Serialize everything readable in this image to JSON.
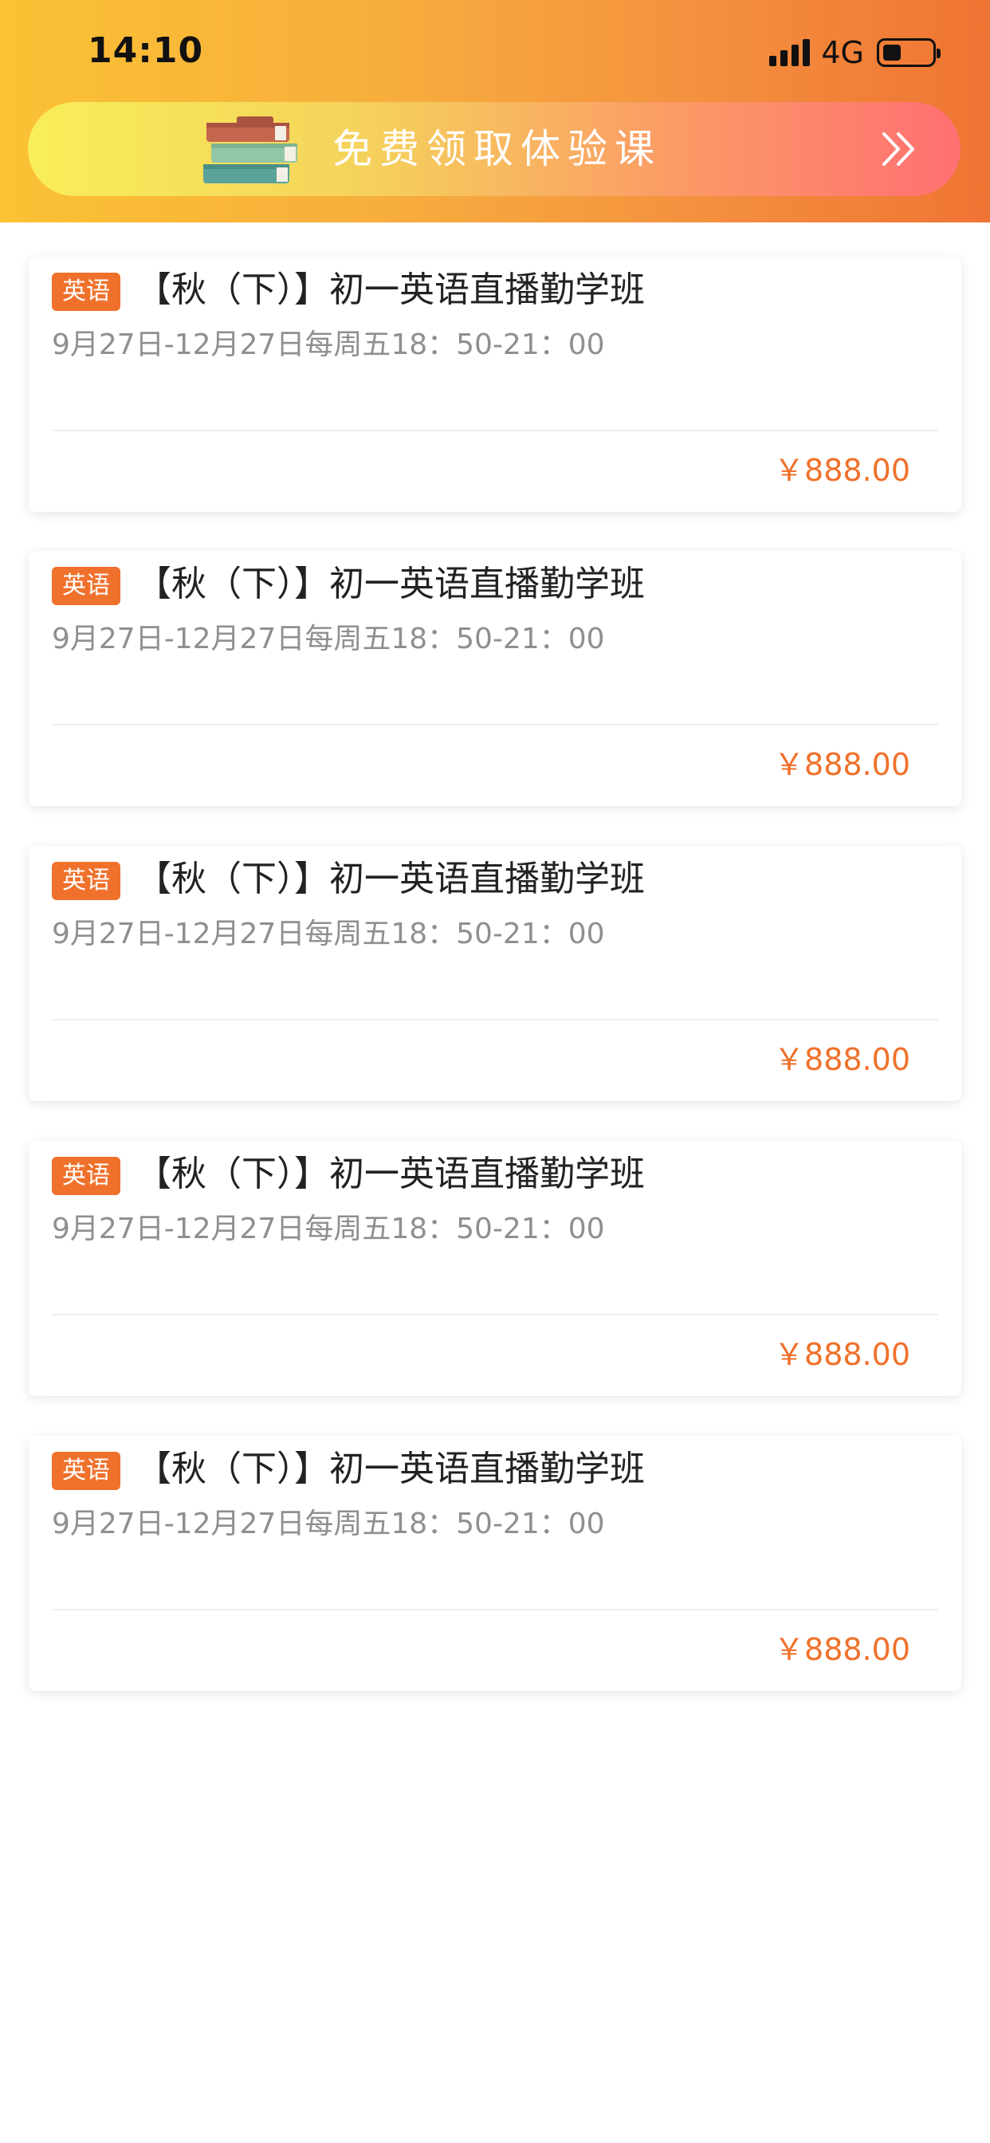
{
  "status_bar": {
    "time": "14:10",
    "network": "4G",
    "signal_icon": "signal-bars-icon",
    "battery_icon": "battery-icon"
  },
  "promo": {
    "text": "免费领取体验课",
    "icon": "books-icon",
    "arrow_icon": "double-chevron-right-icon"
  },
  "colors": {
    "accent": "#f0712b",
    "header_start": "#fbc234",
    "header_end": "#ef7433",
    "schedule_text": "#8f8f8f"
  },
  "courses": [
    {
      "subject": "英语",
      "title": "【秋（下）】初一英语直播勤学班",
      "schedule": "9月27日-12月27日每周五18：50-21：00",
      "price": "￥888.00"
    },
    {
      "subject": "英语",
      "title": "【秋（下）】初一英语直播勤学班",
      "schedule": "9月27日-12月27日每周五18：50-21：00",
      "price": "￥888.00"
    },
    {
      "subject": "英语",
      "title": "【秋（下）】初一英语直播勤学班",
      "schedule": "9月27日-12月27日每周五18：50-21：00",
      "price": "￥888.00"
    },
    {
      "subject": "英语",
      "title": "【秋（下）】初一英语直播勤学班",
      "schedule": "9月27日-12月27日每周五18：50-21：00",
      "price": "￥888.00"
    },
    {
      "subject": "英语",
      "title": "【秋（下）】初一英语直播勤学班",
      "schedule": "9月27日-12月27日每周五18：50-21：00",
      "price": "￥888.00"
    }
  ]
}
